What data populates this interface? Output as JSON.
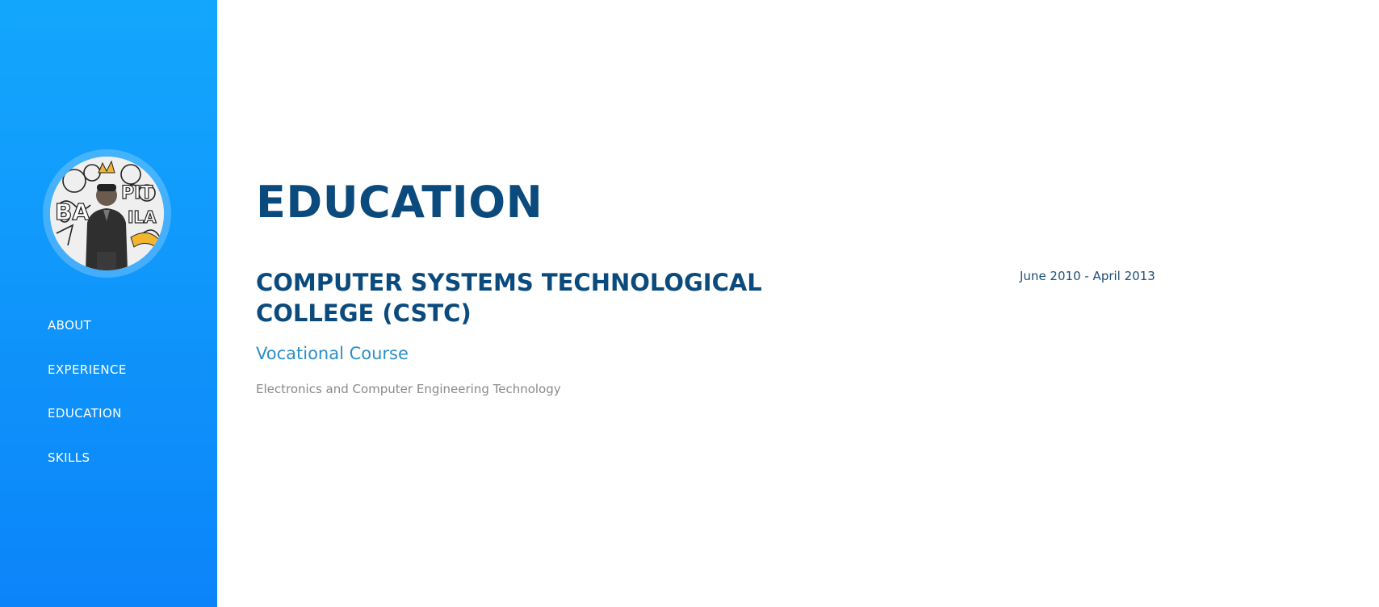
{
  "sidebar": {
    "nav": [
      {
        "label": "ABOUT"
      },
      {
        "label": "EXPERIENCE"
      },
      {
        "label": "EDUCATION"
      },
      {
        "label": "SKILLS"
      }
    ]
  },
  "education": {
    "heading": "EDUCATION",
    "entry": {
      "school": "COMPUTER SYSTEMS TECHNOLOGICAL COLLEGE (CSTC)",
      "course": "Vocational Course",
      "description": "Electronics and Computer Engineering Technology",
      "dates": "June 2010 - April 2013"
    }
  },
  "colors": {
    "sidebar_top": "#13a7fd",
    "sidebar_bottom": "#0b84f9",
    "heading": "#0b4a7c",
    "course": "#2a90c6",
    "description": "#8a8a8a"
  }
}
